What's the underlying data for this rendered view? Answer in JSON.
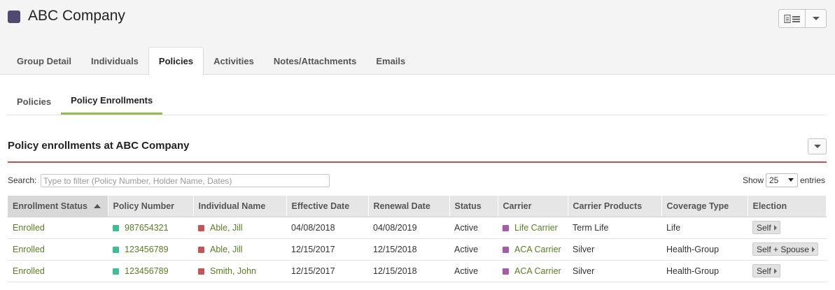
{
  "header": {
    "company_name": "ABC Company",
    "company_color": "#4f4a72",
    "report_icon": "report-list-icon",
    "dropdown_icon": "chevron-down-icon"
  },
  "main_tabs": [
    {
      "label": "Group Detail",
      "active": false
    },
    {
      "label": "Individuals",
      "active": false
    },
    {
      "label": "Policies",
      "active": true
    },
    {
      "label": "Activities",
      "active": false
    },
    {
      "label": "Notes/Attachments",
      "active": false
    },
    {
      "label": "Emails",
      "active": false
    }
  ],
  "sub_tabs": [
    {
      "label": "Policies",
      "active": false
    },
    {
      "label": "Policy Enrollments",
      "active": true
    }
  ],
  "section": {
    "title": "Policy enrollments at ABC Company",
    "accent_color": "#c84e4e"
  },
  "search": {
    "label": "Search:",
    "placeholder": "Type to filter (Policy Number, Holder Name, Dates)",
    "value": ""
  },
  "page_size": {
    "show_label": "Show",
    "selected": "25",
    "entries_label": "entries"
  },
  "table": {
    "columns": [
      "Enrollment Status",
      "Policy Number",
      "Individual Name",
      "Effective Date",
      "Renewal Date",
      "Status",
      "Carrier",
      "Carrier Products",
      "Coverage Type",
      "Election"
    ],
    "sorted_column": "Enrollment Status",
    "sort_direction": "ascending",
    "rows": [
      {
        "enrollment_status": "Enrolled",
        "policy_number": "987654321",
        "individual_name": "Able, Jill",
        "effective_date": "04/08/2018",
        "renewal_date": "04/08/2019",
        "status": "Active",
        "carrier": "Life Carrier",
        "carrier_products": "Term Life",
        "coverage_type": "Life",
        "election": "Self"
      },
      {
        "enrollment_status": "Enrolled",
        "policy_number": "123456789",
        "individual_name": "Able, Jill",
        "effective_date": "12/15/2017",
        "renewal_date": "12/15/2018",
        "status": "Active",
        "carrier": "ACA Carrier",
        "carrier_products": "Silver",
        "coverage_type": "Health-Group",
        "election": "Self + Spouse"
      },
      {
        "enrollment_status": "Enrolled",
        "policy_number": "123456789",
        "individual_name": "Smith, John",
        "effective_date": "12/15/2017",
        "renewal_date": "12/15/2018",
        "status": "Active",
        "carrier": "ACA Carrier",
        "carrier_products": "Silver",
        "coverage_type": "Health-Group",
        "election": "Self"
      }
    ]
  },
  "colors": {
    "policy_marker": "#3dbf94",
    "individual_marker": "#c95252",
    "carrier_marker": "#a85aa8",
    "link_text": "#5a7f1f",
    "active_subtab_underline": "#8fbf4a"
  }
}
